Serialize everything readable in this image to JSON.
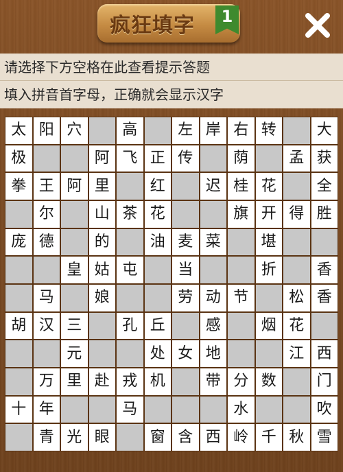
{
  "header": {
    "title": "疯狂填字",
    "level": "1"
  },
  "hints": {
    "line1": "请选择下方空格在此查看提示答题",
    "line2": "填入拼音首字母，正确就会显示汉字"
  },
  "grid": {
    "rows": [
      [
        "太",
        "阳",
        "穴",
        "",
        "高",
        "",
        "左",
        "岸",
        "右",
        "转",
        "",
        "大"
      ],
      [
        "极",
        "",
        "",
        "阿",
        "飞",
        "正",
        "传",
        "",
        "荫",
        "",
        "孟",
        "获"
      ],
      [
        "拳",
        "王",
        "阿",
        "里",
        "",
        "红",
        "",
        "迟",
        "桂",
        "花",
        "",
        "全"
      ],
      [
        "",
        "尔",
        "",
        "山",
        "茶",
        "花",
        "",
        "",
        "旗",
        "开",
        "得",
        "胜"
      ],
      [
        "庞",
        "德",
        "",
        "的",
        "",
        "油",
        "麦",
        "菜",
        "",
        "堪",
        "",
        ""
      ],
      [
        "",
        "",
        "皇",
        "姑",
        "屯",
        "",
        "当",
        "",
        "",
        "折",
        "",
        "香"
      ],
      [
        "",
        "马",
        "",
        "娘",
        "",
        "",
        "劳",
        "动",
        "节",
        "",
        "松",
        "香"
      ],
      [
        "胡",
        "汉",
        "三",
        "",
        "孔",
        "丘",
        "",
        "感",
        "",
        "烟",
        "花",
        ""
      ],
      [
        "",
        "",
        "元",
        "",
        "",
        "处",
        "女",
        "地",
        "",
        "",
        "江",
        "西"
      ],
      [
        "",
        "万",
        "里",
        "赴",
        "戎",
        "机",
        "",
        "带",
        "分",
        "数",
        "",
        "门"
      ],
      [
        "十",
        "年",
        "",
        "",
        "马",
        "",
        "",
        "",
        "水",
        "",
        "",
        "吹"
      ],
      [
        "",
        "青",
        "光",
        "眼",
        "",
        "窗",
        "含",
        "西",
        "岭",
        "千",
        "秋",
        "雪"
      ]
    ]
  },
  "colors": {
    "background": "#7a4a22",
    "hint_panel": "#e9dfd0",
    "cell_filled": "#ffffff",
    "cell_empty": "#c8c8c8",
    "grid_line": "#5a3312",
    "badge": "#3f8a2e"
  },
  "icons": {
    "close": "close-icon",
    "level": "ribbon-badge-icon"
  }
}
